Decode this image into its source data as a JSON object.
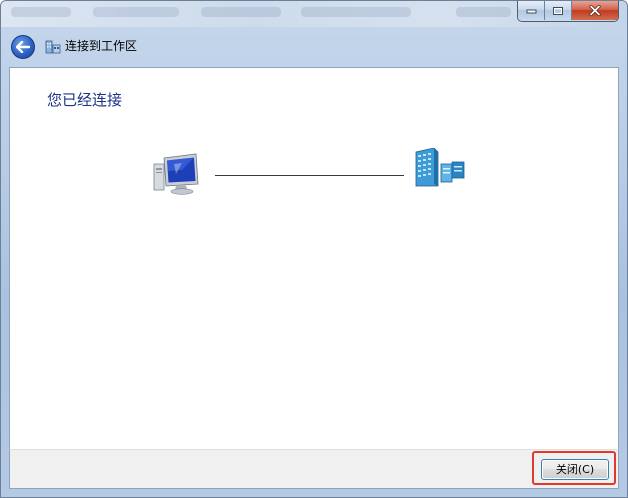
{
  "window": {
    "title": "连接到工作区"
  },
  "content": {
    "heading": "您已经连接"
  },
  "footer": {
    "close_label": "关闭(C)"
  },
  "colors": {
    "heading": "#1e3287",
    "highlight": "#e03a2c",
    "close_button_border": "#3c7fb1"
  },
  "icons": {
    "back": "back-arrow-icon",
    "nav": "workplace-icon",
    "computer": "computer-icon",
    "network": "corporate-network-icon"
  }
}
